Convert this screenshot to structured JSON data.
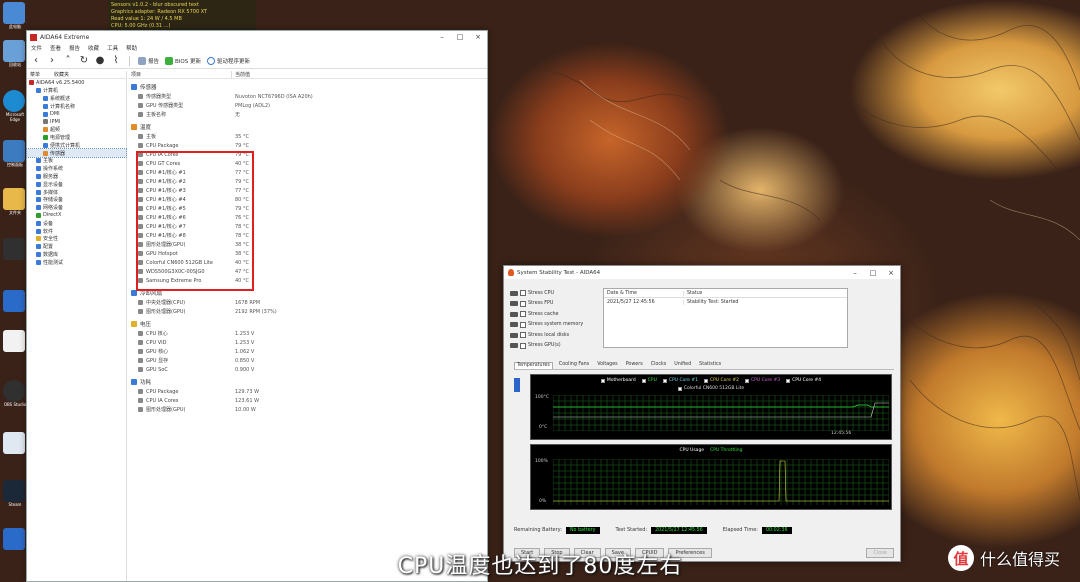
{
  "osd": {
    "lines": [
      "Sensors v1.0.2 - blur obscured text",
      "Graphics adapter: Radeon RX 5700 XT",
      "Read value 1: 24 W / 4.5 MB",
      "CPU: 5.00 GHz (0.31 ...)"
    ]
  },
  "desktop": {
    "icons": [
      {
        "name": "此电脑",
        "color": "#4a8ad4"
      },
      {
        "name": "回收站",
        "color": "#6aa0d8"
      },
      {
        "name": "Microsoft Edge",
        "color": "#1d8bd1"
      },
      {
        "name": "控制面板",
        "color": "#3c7bc0"
      },
      {
        "name": "文件夹",
        "color": "#e8b84a"
      },
      {
        "name": "OBS Studio",
        "color": "#303030"
      },
      {
        "name": "Steam",
        "color": "#1b2838"
      },
      {
        "name": "文件",
        "color": "#f2f2f2"
      },
      {
        "name": "应用",
        "color": "#2a6ac8"
      }
    ]
  },
  "aida": {
    "title": "AIDA64 Extreme",
    "menu": [
      "文件",
      "查看",
      "报告",
      "收藏",
      "工具",
      "帮助"
    ],
    "toolbar": {
      "report": "报告",
      "bios": "BIOS 更新",
      "driver": "驱动程序更新"
    },
    "left_header": [
      "菜单",
      "收藏夹"
    ],
    "tree": [
      {
        "label": "AIDA64 v6.25.5400",
        "color": "#c62828",
        "indent": 0
      },
      {
        "label": "计算机",
        "color": "#3a7bd5",
        "indent": 1
      },
      {
        "label": "系统概述",
        "color": "#3a7bd5",
        "indent": 2
      },
      {
        "label": "计算机名称",
        "color": "#3a7bd5",
        "indent": 2
      },
      {
        "label": "DMI",
        "color": "#3a7bd5",
        "indent": 2
      },
      {
        "label": "IPMI",
        "color": "#777777",
        "indent": 2
      },
      {
        "label": "超频",
        "color": "#e08a2a",
        "indent": 2
      },
      {
        "label": "电源管理",
        "color": "#2aa02a",
        "indent": 2
      },
      {
        "label": "便携式计算机",
        "color": "#3a7bd5",
        "indent": 2
      },
      {
        "label": "传感器",
        "color": "#e08a2a",
        "indent": 2,
        "selected": true
      },
      {
        "label": "主板",
        "color": "#3a7bd5",
        "indent": 1
      },
      {
        "label": "操作系统",
        "color": "#3a7bd5",
        "indent": 1
      },
      {
        "label": "服务器",
        "color": "#3a7bd5",
        "indent": 1
      },
      {
        "label": "显示设备",
        "color": "#3a7bd5",
        "indent": 1
      },
      {
        "label": "多媒体",
        "color": "#3a7bd5",
        "indent": 1
      },
      {
        "label": "存储设备",
        "color": "#3a7bd5",
        "indent": 1
      },
      {
        "label": "网络设备",
        "color": "#3a7bd5",
        "indent": 1
      },
      {
        "label": "DirectX",
        "color": "#2aa02a",
        "indent": 1
      },
      {
        "label": "设备",
        "color": "#3a7bd5",
        "indent": 1
      },
      {
        "label": "软件",
        "color": "#3a7bd5",
        "indent": 1
      },
      {
        "label": "安全性",
        "color": "#e0b02a",
        "indent": 1
      },
      {
        "label": "配置",
        "color": "#3a7bd5",
        "indent": 1
      },
      {
        "label": "数据库",
        "color": "#3a7bd5",
        "indent": 1
      },
      {
        "label": "性能测试",
        "color": "#3a7bd5",
        "indent": 1
      }
    ],
    "columns": [
      "项目",
      "当前值"
    ],
    "groups": {
      "sensor": {
        "title": "传感器",
        "rows": [
          {
            "field": "传感器类型",
            "value": "Nuvoton NCT6796D (ISA A20h)"
          },
          {
            "field": "GPU 传感器类型",
            "value": "PMLog (ADL2)"
          },
          {
            "field": "主板名称",
            "value": "无"
          }
        ]
      },
      "temp": {
        "title": "温度",
        "rows": [
          {
            "field": "主板",
            "value": "35 °C"
          },
          {
            "field": "CPU Package",
            "value": "79 °C"
          },
          {
            "field": "CPU IA Cores",
            "value": "79 °C"
          },
          {
            "field": "CPU GT Cores",
            "value": "40 °C"
          },
          {
            "field": "CPU #1/核心 #1",
            "value": "77 °C"
          },
          {
            "field": "CPU #1/核心 #2",
            "value": "79 °C"
          },
          {
            "field": "CPU #1/核心 #3",
            "value": "77 °C"
          },
          {
            "field": "CPU #1/核心 #4",
            "value": "80 °C"
          },
          {
            "field": "CPU #1/核心 #5",
            "value": "79 °C"
          },
          {
            "field": "CPU #1/核心 #6",
            "value": "76 °C"
          },
          {
            "field": "CPU #1/核心 #7",
            "value": "78 °C"
          },
          {
            "field": "CPU #1/核心 #8",
            "value": "78 °C"
          },
          {
            "field": "图形处理器(GPU)",
            "value": "38 °C"
          },
          {
            "field": "GPU Hotspot",
            "value": "38 °C"
          },
          {
            "field": "Colorful CN600 512GB Lite",
            "value": "40 °C"
          },
          {
            "field": "WDS500G3X0C-00SJG0",
            "value": "47 °C"
          },
          {
            "field": "Samsung Extreme Pro",
            "value": "40 °C"
          }
        ]
      },
      "fan": {
        "title": "冷却风扇",
        "rows": [
          {
            "field": "中央处理器(CPU)",
            "value": "1678 RPM"
          },
          {
            "field": "图形处理器(GPU)",
            "value": "2192 RPM  (37%)"
          }
        ]
      },
      "volt": {
        "title": "电压",
        "rows": [
          {
            "field": "CPU 核心",
            "value": "1.253 V"
          },
          {
            "field": "CPU VID",
            "value": "1.253 V"
          },
          {
            "field": "GPU 核心",
            "value": "1.062 V"
          },
          {
            "field": "GPU 显存",
            "value": "0.850 V"
          },
          {
            "field": "GPU SoC",
            "value": "0.900 V"
          }
        ]
      },
      "power": {
        "title": "功耗",
        "rows": [
          {
            "field": "CPU Package",
            "value": "129.73 W"
          },
          {
            "field": "CPU IA Cores",
            "value": "123.61 W"
          },
          {
            "field": "图形处理器(GPU)",
            "value": "10.00 W"
          }
        ]
      }
    }
  },
  "sst": {
    "title": "System Stability Test - AIDA64",
    "stress": [
      "Stress CPU",
      "Stress FPU",
      "Stress cache",
      "Stress system memory",
      "Stress local disks",
      "Stress GPU(s)"
    ],
    "log_head": [
      "Date & Time",
      "Status"
    ],
    "log_rows": [
      {
        "time": "2021/5/27 12:45:56",
        "status": "Stability Test: Started"
      }
    ],
    "tabs": [
      "Temperatures",
      "Cooling Fans",
      "Voltages",
      "Powers",
      "Clocks",
      "Unified",
      "Statistics"
    ],
    "temp_legend": [
      "Motherboard",
      "CPU",
      "CPU Core #1",
      "CPU Core #2",
      "CPU Core #3",
      "CPU Core #4"
    ],
    "temp_legend2": "Colorful CN600 512GB Lite",
    "temp_axis": {
      "top": "100°C",
      "bottom": "0°C",
      "time": "12:45:56"
    },
    "usage_legend": [
      "CPU Usage",
      "CPU Throttling"
    ],
    "usage_axis": {
      "top": "100%",
      "bottom": "0%"
    },
    "status": {
      "battery_label": "Remaining Battery:",
      "battery_value": "No battery",
      "started_label": "Test Started:",
      "started_value": "2021/5/27 12:45:56",
      "elapsed_label": "Elapsed Time:",
      "elapsed_value": "00:02:36"
    },
    "buttons": {
      "start": "Start",
      "stop": "Stop",
      "clear": "Clear",
      "save": "Save",
      "cpuid": "CPUID",
      "prefs": "Preferences",
      "close": "Close"
    }
  },
  "subtitle": "CPU温度也达到了80度左右",
  "watermark": {
    "logo": "值",
    "text": "什么值得买"
  }
}
